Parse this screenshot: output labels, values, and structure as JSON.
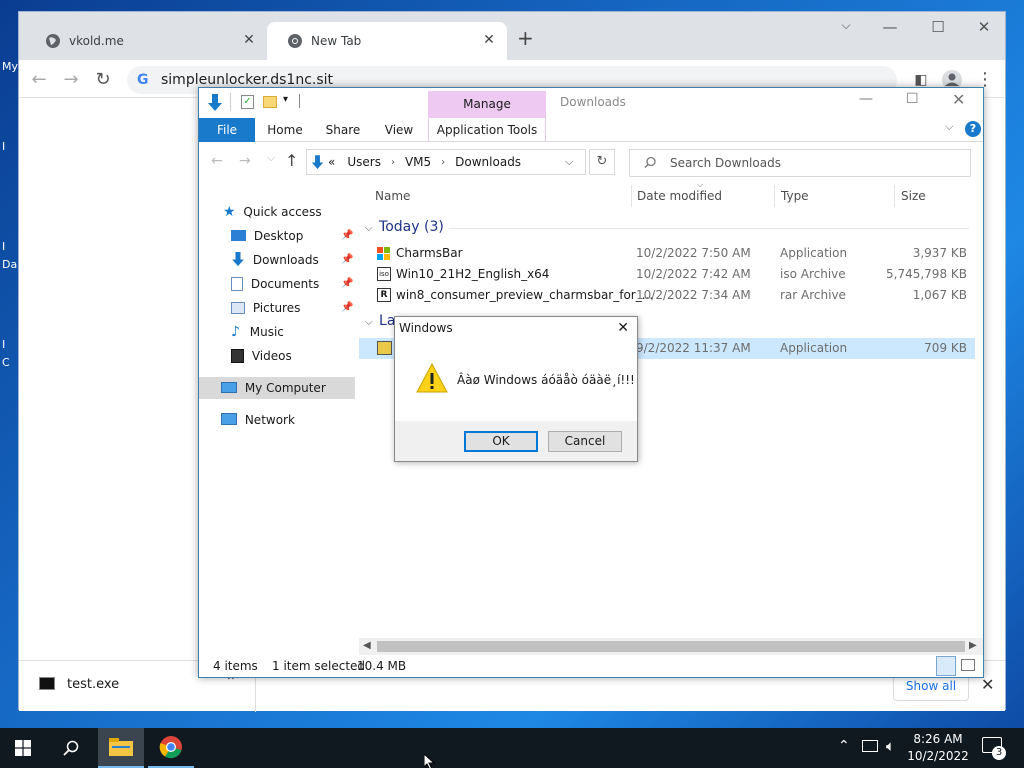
{
  "desktop": {
    "letters": [
      "My",
      "I",
      "I",
      "Da",
      "I",
      "C"
    ]
  },
  "chrome": {
    "tabs": [
      {
        "title": "vkold.me"
      },
      {
        "title": "New Tab"
      }
    ],
    "new_tab": "+",
    "url": "simpleunlocker.ds1nc.sit",
    "download": {
      "filename": "test.exe",
      "show_all": "Show all"
    }
  },
  "explorer": {
    "title": "Downloads",
    "contextual_group": "Manage",
    "ribbon_tabs": [
      "File",
      "Home",
      "Share",
      "View",
      "Application Tools"
    ],
    "breadcrumb": [
      "Users",
      "VM5",
      "Downloads"
    ],
    "breadcrumb_prefix": "«",
    "search_placeholder": "Search Downloads",
    "nav": {
      "quick_access": "Quick access",
      "items": [
        "Desktop",
        "Downloads",
        "Documents",
        "Pictures",
        "Music",
        "Videos"
      ],
      "my_computer": "My Computer",
      "network": "Network"
    },
    "columns": [
      "Name",
      "Date modified",
      "Type",
      "Size"
    ],
    "groups": [
      {
        "label": "Today (3)"
      },
      {
        "label": "La"
      }
    ],
    "files": [
      {
        "name": "CharmsBar",
        "date": "10/2/2022 7:50 AM",
        "type": "Application",
        "size": "3,937 KB",
        "icon": "app-icon"
      },
      {
        "name": "Win10_21H2_English_x64",
        "date": "10/2/2022 7:42 AM",
        "type": "iso Archive",
        "size": "5,745,798 KB",
        "icon": "iso-icon"
      },
      {
        "name": "win8_consumer_preview_charmsbar_for_...",
        "date": "10/2/2022 7:34 AM",
        "type": "rar Archive",
        "size": "1,067 KB",
        "icon": "rar-icon"
      },
      {
        "name": "",
        "date": "9/2/2022 11:37 AM",
        "type": "Application",
        "size": "709 KB",
        "icon": "app-icon"
      }
    ],
    "status": {
      "count": "4 items",
      "selected": "1 item selected",
      "size": "10.4 MB"
    }
  },
  "dialog": {
    "title": "Windows",
    "message": "Âàø Windows áóäåò óäàë¸í!!!",
    "ok": "OK",
    "cancel": "Cancel"
  },
  "taskbar": {
    "time": "8:26 AM",
    "date": "10/2/2022",
    "notifications": "3"
  },
  "colors": {
    "accent": "#1979ca",
    "manage_bg": "#eec9f2",
    "selection": "#cce8ff",
    "taskbar": "#101820"
  }
}
